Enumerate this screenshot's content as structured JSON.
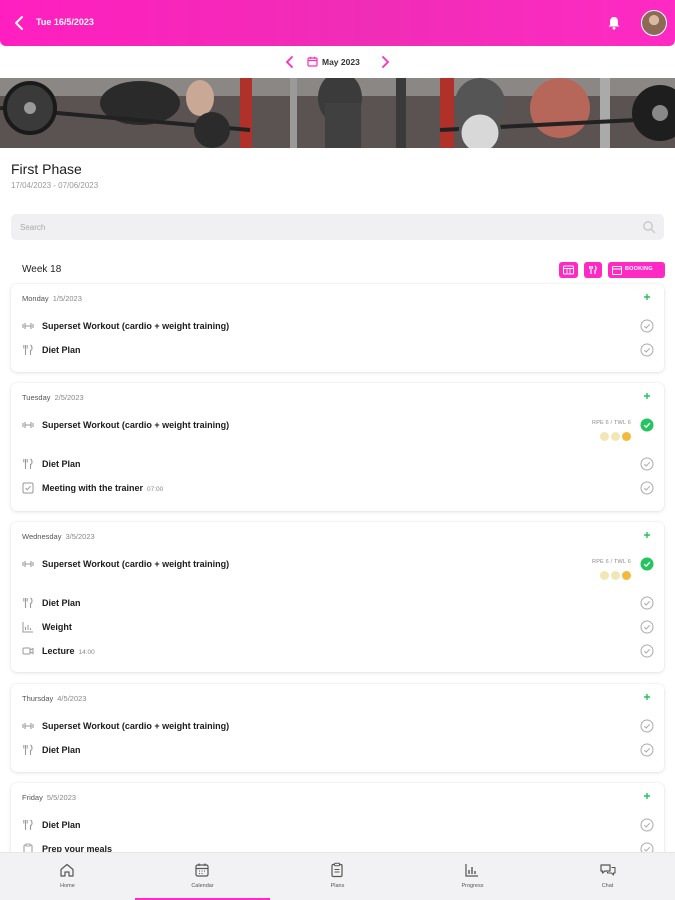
{
  "header": {
    "date": "Tue 16/5/2023",
    "back_icon": "chevron-left-icon",
    "bell_icon": "bell-icon"
  },
  "month_nav": {
    "label": "May 2023"
  },
  "phase": {
    "title": "First Phase",
    "dates": "17/04/2023 - 07/06/2023"
  },
  "search": {
    "placeholder": "Search"
  },
  "week": {
    "label": "Week 18",
    "booking_label": "BOOKING"
  },
  "days": [
    {
      "name": "Monday",
      "date": "1/5/2023",
      "items": [
        {
          "icon": "dumbbell-icon",
          "text": "Superset Workout (cardio + weight training)",
          "done": false
        },
        {
          "icon": "fork-knife-icon",
          "text": "Diet Plan",
          "done": false
        }
      ]
    },
    {
      "name": "Tuesday",
      "date": "2/5/2023",
      "items": [
        {
          "icon": "dumbbell-icon",
          "text": "Superset Workout (cardio + weight training)",
          "done": true,
          "rpe": "RPE 6 / TWL 6"
        },
        {
          "icon": "fork-knife-icon",
          "text": "Diet Plan",
          "done": false
        },
        {
          "icon": "meeting-icon",
          "text": "Meeting with the trainer",
          "time": "07:00",
          "done": false
        }
      ]
    },
    {
      "name": "Wednesday",
      "date": "3/5/2023",
      "items": [
        {
          "icon": "dumbbell-icon",
          "text": "Superset Workout (cardio + weight training)",
          "done": true,
          "rpe": "RPE 6 / TWL 6"
        },
        {
          "icon": "fork-knife-icon",
          "text": "Diet Plan",
          "done": false
        },
        {
          "icon": "chart-icon",
          "text": "Weight",
          "done": false
        },
        {
          "icon": "video-icon",
          "text": "Lecture",
          "time": "14:00",
          "done": false
        }
      ]
    },
    {
      "name": "Thursday",
      "date": "4/5/2023",
      "items": [
        {
          "icon": "dumbbell-icon",
          "text": "Superset Workout (cardio + weight training)",
          "done": false
        },
        {
          "icon": "fork-knife-icon",
          "text": "Diet Plan",
          "done": false
        }
      ]
    },
    {
      "name": "Friday",
      "date": "5/5/2023",
      "items": [
        {
          "icon": "fork-knife-icon",
          "text": "Diet Plan",
          "done": false
        },
        {
          "icon": "clipboard-icon",
          "text": "Prep your meals",
          "done": false
        }
      ]
    }
  ],
  "tabs": [
    {
      "label": "Home",
      "icon": "home-icon"
    },
    {
      "label": "Calendar",
      "icon": "calendar-icon",
      "active": true
    },
    {
      "label": "Plans",
      "icon": "clipboard-icon"
    },
    {
      "label": "Progress",
      "icon": "bar-chart-icon"
    },
    {
      "label": "Chat",
      "icon": "chat-icon"
    }
  ],
  "colors": {
    "brand": "#ff2ac4",
    "done": "#22c55e",
    "plus": "#22c55e"
  }
}
